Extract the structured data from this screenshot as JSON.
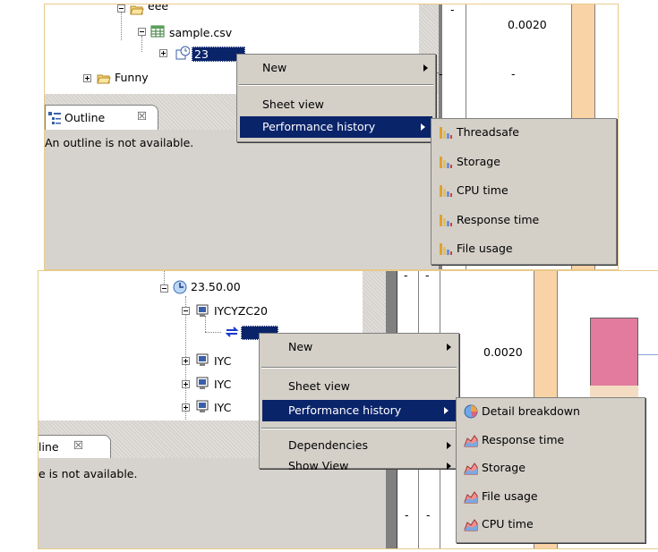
{
  "top": {
    "tree": {
      "folder_eee": "eee",
      "file_csv": "sample.csv",
      "node_selected": "23",
      "folder_funny": "Funny"
    },
    "outline": {
      "tab_label": "Outline",
      "message": "An outline is not available."
    },
    "grid": {
      "cell_value": "0.0020",
      "dash": "-"
    },
    "context_menu": {
      "new": "New",
      "sheet_view": "Sheet view",
      "performance_history": "Performance history"
    },
    "submenu": [
      "Threadsafe",
      "Storage",
      "CPU time",
      "Response time",
      "File usage"
    ]
  },
  "bottom": {
    "tree": {
      "node_time": "23.50.00",
      "region": "IYCYZC20",
      "sub1": "IYC",
      "sub2": "IYC",
      "sub3": "IYC"
    },
    "outline": {
      "tab_label": "line",
      "message": "e is not available."
    },
    "grid": {
      "cell_value": "0.0020",
      "dash": "-"
    },
    "context_menu": {
      "new": "New",
      "sheet_view": "Sheet view",
      "performance_history": "Performance history",
      "dependencies": "Dependencies",
      "show_view": "Show View"
    },
    "submenu": [
      "Detail breakdown",
      "Response time",
      "Storage",
      "File usage",
      "CPU time"
    ]
  },
  "colors": {
    "selection": "#0a246a",
    "menu_bg": "#d4d0c8",
    "panel_gray": "#d6d3ce",
    "peach": "#f9d3a6",
    "pink": "#e27b9e"
  },
  "icons": {
    "top_submenu_icon": "bar-chart-icon",
    "bottom_submenu_first_icon": "pie-chart-icon",
    "bottom_submenu_icon": "area-chart-icon"
  }
}
